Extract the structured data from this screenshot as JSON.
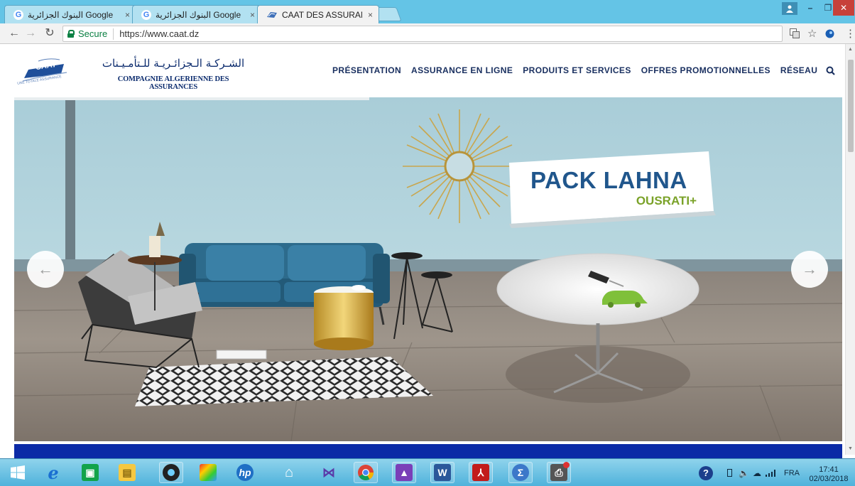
{
  "browser": {
    "tabs": [
      {
        "label": "البنوك الجزائرية Google",
        "icon": "google-icon",
        "active": false
      },
      {
        "label": "البنوك الجزائرية Google",
        "icon": "google-icon",
        "active": false
      },
      {
        "label": "CAAT DES ASSURANCES",
        "icon": "caat-favicon",
        "active": true
      }
    ],
    "tab_close_glyph": "×",
    "address": {
      "secure_label": "Secure",
      "url": "https://www.caat.dz"
    }
  },
  "site": {
    "logo_text": "CAAT",
    "logo_tagline": "UNE TOTALE ASSURANCE",
    "brand_arabic": "الشـركـة الـجزائـريـة للـتأمـيـنات",
    "brand_french": "COMPAGNIE ALGERIENNE DES ASSURANCES",
    "nav": [
      "PRÉSENTATION",
      "ASSURANCE EN LIGNE",
      "PRODUITS ET SERVICES",
      "OFFRES PROMOTIONNELLES",
      "RÉSEAU"
    ]
  },
  "slider": {
    "title": "PACK LAHNA",
    "subtitle": "OUSRATI+",
    "prev_glyph": "←",
    "next_glyph": "→"
  },
  "taskbar": {
    "items": [
      "start-icon",
      "ie-icon",
      "store-icon",
      "explorer-icon",
      "media-icon",
      "paint-icon",
      "hp-icon",
      "home-icon",
      "vs-icon",
      "chrome-icon",
      "photos-icon",
      "word-icon",
      "acrobat-icon",
      "math-icon",
      "printer-icon"
    ],
    "language": "FRA",
    "time": "17:41",
    "date": "02/03/2018"
  },
  "colors": {
    "brand_blue": "#20568c",
    "brand_green": "#7aa228",
    "band_blue": "#0b2aa6",
    "taskbar": "#4fb2db"
  }
}
